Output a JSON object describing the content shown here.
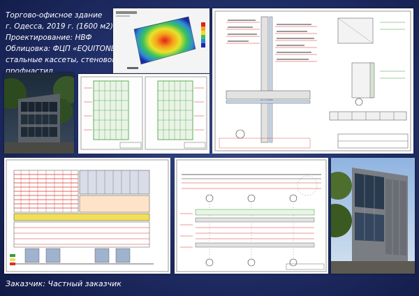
{
  "header": {
    "title_line1": "Торгово-офисное здание",
    "title_line2": "г. Одесса, 2019 г. (1600 м2)",
    "design_line": "Проектирование: НВФ",
    "cladding_line1": "Облицовка: ФЦП «EQUITONE»,",
    "cladding_line2": "стальные кассеты, стеновой",
    "cladding_line3": "профнастил."
  },
  "footer": {
    "client": "Заказчик: Частный заказчик"
  },
  "colors": {
    "background": "#24336f",
    "text": "#ffffff",
    "drawing_red": "#d8302a",
    "drawing_green": "#3a9a3a",
    "drawing_line": "#333333"
  }
}
